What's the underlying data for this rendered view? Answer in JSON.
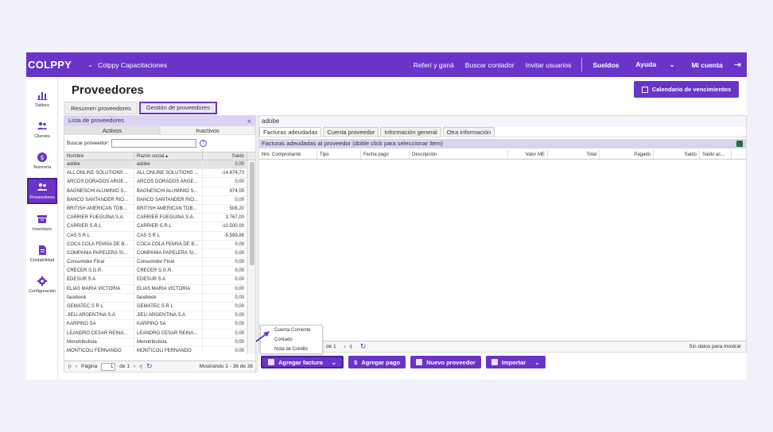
{
  "app": {
    "logo": "COLPPY",
    "company": "Colppy Capacitaciones"
  },
  "topnav": {
    "refer": "Referí y ganá",
    "buscar": "Buscar contador",
    "invitar": "Invitar usuarios",
    "sueldos": "Sueldos",
    "ayuda": "Ayuda",
    "cuenta": "Mi cuenta"
  },
  "sidebar": {
    "items": [
      {
        "label": "Tablero"
      },
      {
        "label": "Clientes"
      },
      {
        "label": "Tesorería"
      },
      {
        "label": "Proveedores"
      },
      {
        "label": "Inventario"
      },
      {
        "label": "Contabilidad"
      },
      {
        "label": "Configuración"
      }
    ]
  },
  "page": {
    "title": "Proveedores",
    "calendar_button": "Calendario de vencimientos"
  },
  "tabs": [
    "Resumen proveedores",
    "Gestión de proveedores"
  ],
  "left": {
    "header": "Lista de proveedores",
    "subtabs": [
      "Activos",
      "Inactivos"
    ],
    "search_label": "Buscar proveedor:",
    "columns": [
      "Nombre",
      "Razón social",
      "Saldo"
    ],
    "rows": [
      [
        "adobe",
        "adobe",
        "0,00"
      ],
      [
        "ALL ONLINE SOLUTIONS ...",
        "ALL ONLINE SOLUTIONS ...",
        "-14.674,70"
      ],
      [
        "ARCOS DORADOS ARGE...",
        "ARCOS DORADOS ARGE...",
        "0,00"
      ],
      [
        "BAGNESCHI ALUMINIO S...",
        "BAGNESCHI ALUMINIO S...",
        "974,05"
      ],
      [
        "BANCO SANTANDER RIO...",
        "BANCO SANTANDER RIO...",
        "0,00"
      ],
      [
        "BRITISH AMERICAN TOB...",
        "BRITISH AMERICAN TOB...",
        "508,20"
      ],
      [
        "CARRIER FUEGUINA S.A.",
        "CARRIER FUEGUINA S.A.",
        "3.767,00"
      ],
      [
        "CARRIER S.R.L",
        "CARRIER S.R.L",
        "-10.500,00"
      ],
      [
        "CAS S R L",
        "CAS S R L",
        "-5.599,88"
      ],
      [
        "COCA COLA FEMSA DE B...",
        "COCA COLA FEMSA DE B...",
        "0,00"
      ],
      [
        "COMPANIA PAPELERA SI...",
        "COMPANIA PAPELERA SI...",
        "0,00"
      ],
      [
        "Consumidor Final",
        "Consumidor Final",
        "0,00"
      ],
      [
        "CRECER S.G.R.",
        "CRECER S.G.R.",
        "0,00"
      ],
      [
        "EDESUR S A",
        "EDESUR S A",
        "0,00"
      ],
      [
        "ELIAS MARIA VICTORIA",
        "ELIAS MARIA VICTORIA",
        "0,00"
      ],
      [
        "facebook",
        "facebook",
        "0,00"
      ],
      [
        "GEMATEC S R L",
        "GEMATEC S R L",
        "0,00"
      ],
      [
        "JIELI ARGENTINA S.A",
        "JIELI ARGENTINA S.A",
        "0,00"
      ],
      [
        "KARPINO SA",
        "KARPINO SA",
        "0,00"
      ],
      [
        "LEANDRO CESAR REINA...",
        "LEANDRO CESAR REINA...",
        "0,00"
      ],
      [
        "Monotributista",
        "Monotributista",
        "0,00"
      ],
      [
        "MONTICOLI FERNANDO",
        "MONTICOLI FERNANDO",
        "0,00"
      ]
    ],
    "pager": {
      "page_label": "Página",
      "page_value": "1",
      "of_label": "de 1",
      "showing": "Mostrando 1 - 36 de 36"
    }
  },
  "right": {
    "title": "adobe",
    "tabs": [
      "Facturas adeudadas",
      "Cuenta proveedor",
      "Información general",
      "Otra información"
    ],
    "subheader": "Facturas adeudadas al proveedor (doble click para seleccionar ítem)",
    "columns": [
      "Nro. Comprobante",
      "Tipo",
      "Fecha pago",
      "Descripción",
      "Valor ME",
      "Total",
      "Pagado",
      "Saldo",
      "Saldo ac..."
    ],
    "footer_page": "de 1",
    "footer_empty": "Sin datos para mostrar"
  },
  "dropdown": [
    "Cuenta Corriente",
    "Contado",
    "Nota de Crédito"
  ],
  "actions": {
    "agregar_factura": "Agregar factura",
    "agregar_pago": "Agregar pago",
    "nuevo_proveedor": "Nuevo proveedor",
    "importar": "Importar"
  }
}
